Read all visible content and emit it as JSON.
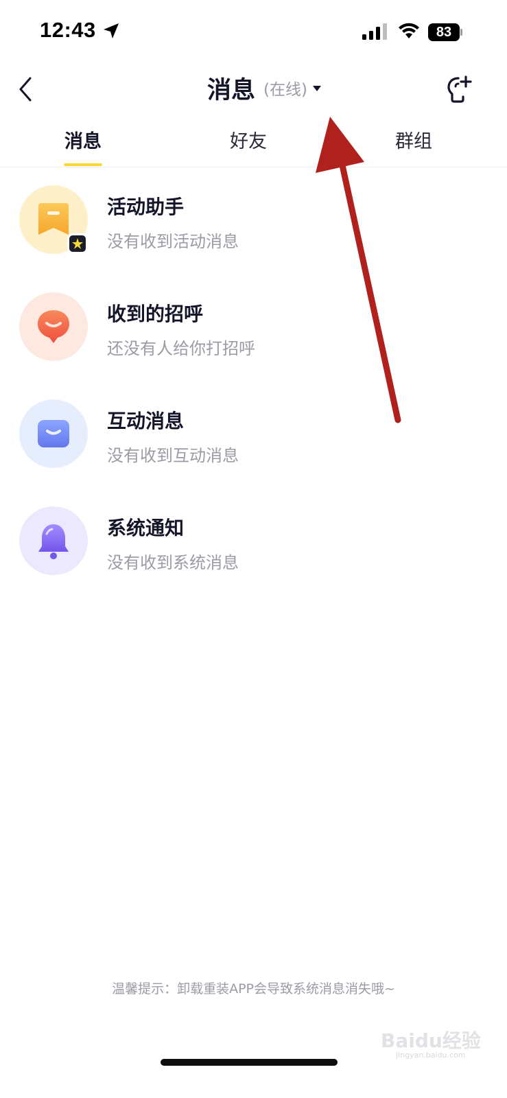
{
  "status_bar": {
    "time": "12:43",
    "battery": "83"
  },
  "header": {
    "title": "消息",
    "status": "(在线)",
    "icons": [
      "back-icon",
      "caret-down-icon",
      "add-friend-icon"
    ]
  },
  "tabs": [
    {
      "label": "消息",
      "active": true
    },
    {
      "label": "好友",
      "active": false
    },
    {
      "label": "群组",
      "active": false
    }
  ],
  "messages": [
    {
      "title": "活动助手",
      "subtitle": "没有收到活动消息",
      "icon": "activity-icon",
      "color": "#f7b63c"
    },
    {
      "title": "收到的招呼",
      "subtitle": "还没有人给你打招呼",
      "icon": "greeting-icon",
      "color": "#f0644a"
    },
    {
      "title": "互动消息",
      "subtitle": "没有收到互动消息",
      "icon": "interaction-icon",
      "color": "#6c8cf5"
    },
    {
      "title": "系统通知",
      "subtitle": "没有收到系统消息",
      "icon": "bell-icon",
      "color": "#8a6cf0"
    }
  ],
  "footer": {
    "tip": "温馨提示：卸载重装APP会导致系统消息消失哦~"
  },
  "watermark": {
    "text": "Baidu经验",
    "sub": "jingyan.baidu.com"
  },
  "colors": {
    "accent": "#f7d933",
    "annotation_arrow": "#b0201c"
  }
}
